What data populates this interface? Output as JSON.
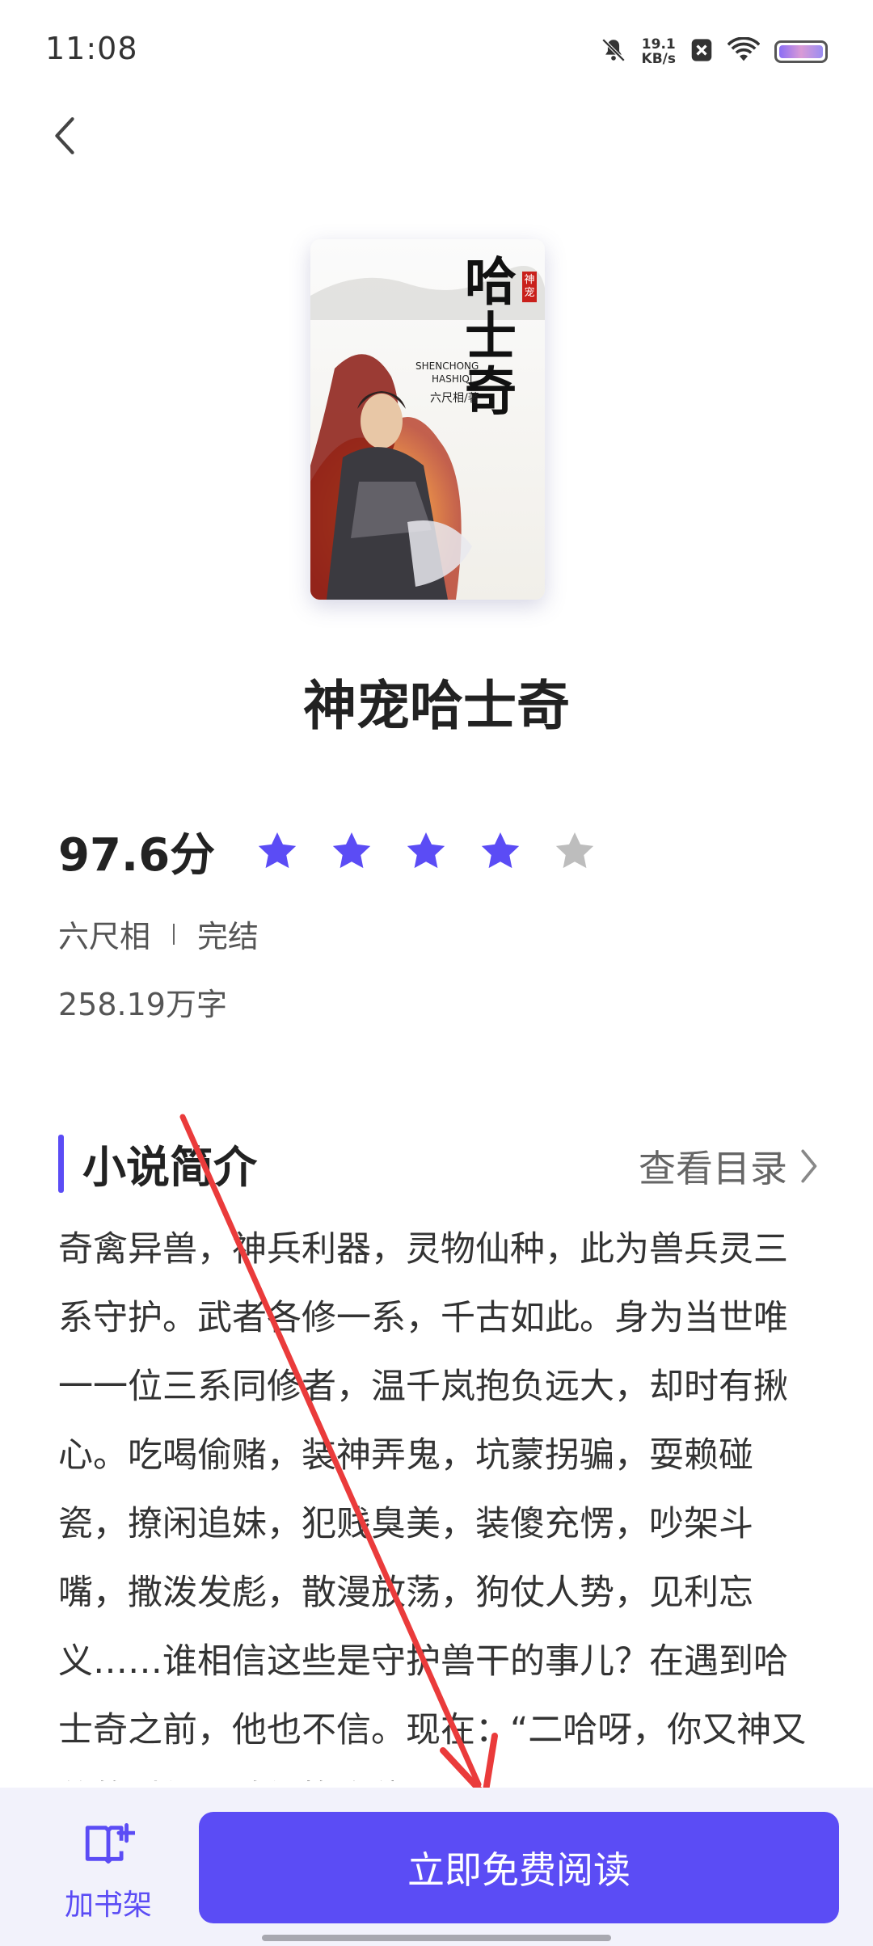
{
  "status_bar": {
    "time": "11:08",
    "speed_value": "19.1",
    "speed_unit": "KB/s",
    "icons": [
      "bell-muted-icon",
      "close-box-icon",
      "wifi-icon",
      "battery-icon"
    ]
  },
  "nav": {
    "back_icon": "chevron-left-icon"
  },
  "book": {
    "cover_title": "哈士奇",
    "cover_badge": "神宠",
    "cover_pinyin_1": "SHENCHONG",
    "cover_pinyin_2": "HASHIQI",
    "cover_author": "六尺相/著",
    "title": "神宠哈士奇",
    "score": "97.6分",
    "rating": {
      "value": 4,
      "max": 5
    },
    "author": "六尺相",
    "status": "完结",
    "word_count": "258.19万字"
  },
  "synopsis_section": {
    "title": "小说简介",
    "toc_label": "查看目录",
    "text": "奇禽异兽，神兵利器，灵物仙种，此为兽兵灵三系守护。武者各修一系，千古如此。身为当世唯一一位三系同修者，温千岚抱负远大，却时有揪心。吃喝偷赌，装神弄鬼，坑蒙拐骗，耍赖碰瓷，撩闲追妹，犯贱臭美，装傻充愣，吵架斗嘴，撒泼发彪，散漫放荡，狗仗人势，见利忘义……谁相信这些是守护兽干的事儿？在遇到哈士奇之前，他也不信。现在：“二哈呀，你又神又怂的时候，咱俩换个位置……”"
  },
  "bottom_bar": {
    "shelf_label": "加书架",
    "read_label": "立即免费阅读"
  },
  "colors": {
    "accent": "#5b4cf5",
    "star_active": "#5b4cf5",
    "star_inactive": "#bdbdbd",
    "annotation_arrow": "#ea3b3b"
  }
}
